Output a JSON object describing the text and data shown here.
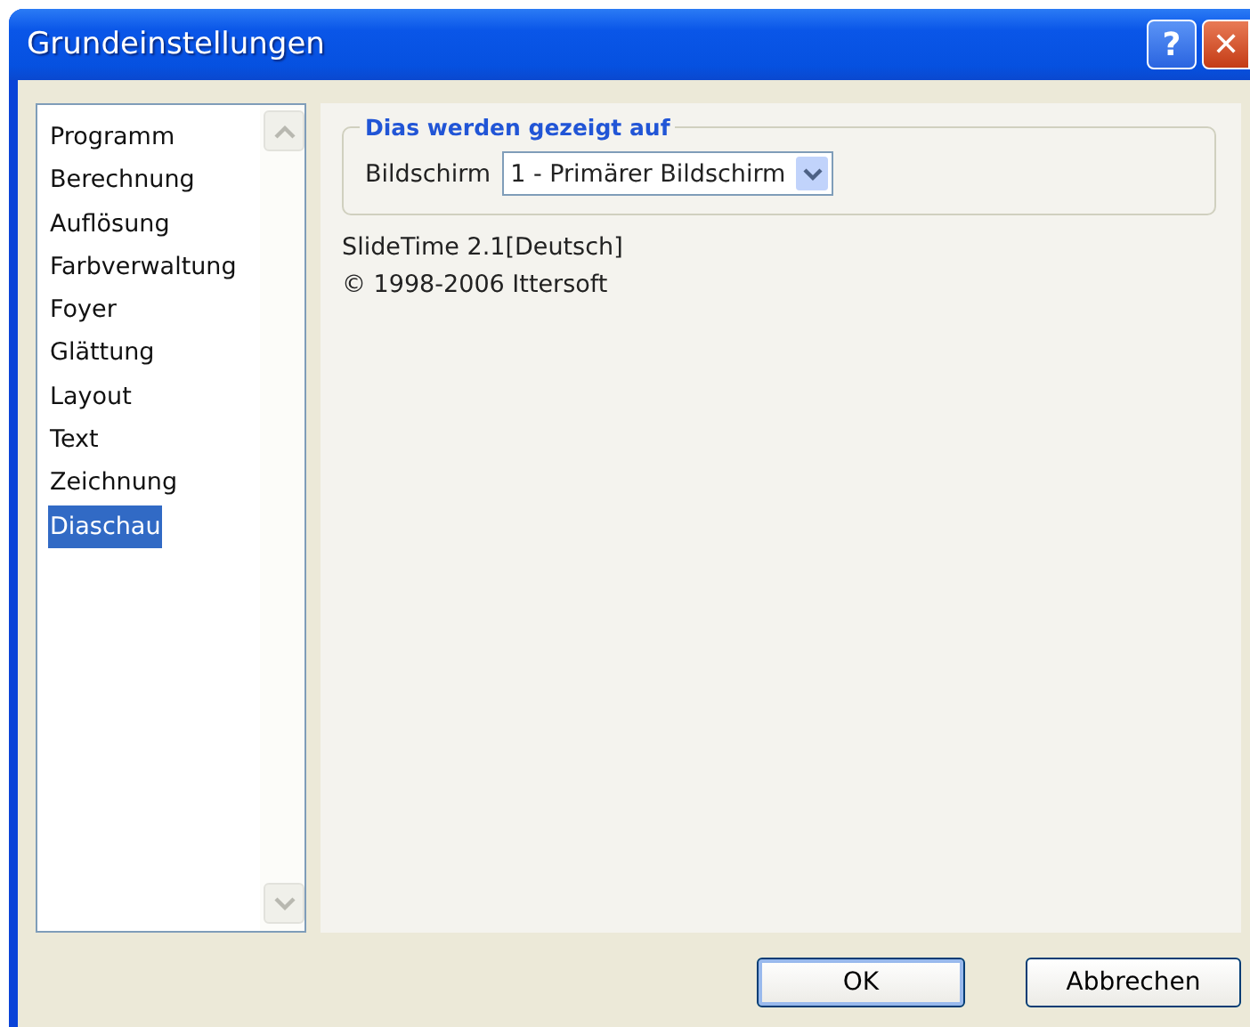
{
  "window": {
    "title": "Grundeinstellungen",
    "title_buttons": [
      {
        "kind": "help",
        "label": "?"
      },
      {
        "kind": "close",
        "label": "✕"
      }
    ]
  },
  "sidebar": {
    "items": [
      {
        "label": "Programm",
        "selected": false
      },
      {
        "label": "Berechnung",
        "selected": false
      },
      {
        "label": "Auflösung",
        "selected": false
      },
      {
        "label": "Farbverwaltung",
        "selected": false
      },
      {
        "label": "Foyer",
        "selected": false
      },
      {
        "label": "Glättung",
        "selected": false
      },
      {
        "label": "Layout",
        "selected": false
      },
      {
        "label": "Text",
        "selected": false
      },
      {
        "label": "Zeichnung",
        "selected": false
      },
      {
        "label": "Diaschau",
        "selected": true
      }
    ]
  },
  "group": {
    "title": "Dias werden gezeigt auf",
    "field_label": "Bildschirm",
    "dropdown_value": "1 - Primärer Bildschirm"
  },
  "info": [
    "SlideTime 2.1[Deutsch]",
    "© 1998-2006 Ittersoft"
  ],
  "buttons": [
    {
      "label": "OK",
      "default": true
    },
    {
      "label": "Abbrechen",
      "default": false
    }
  ]
}
